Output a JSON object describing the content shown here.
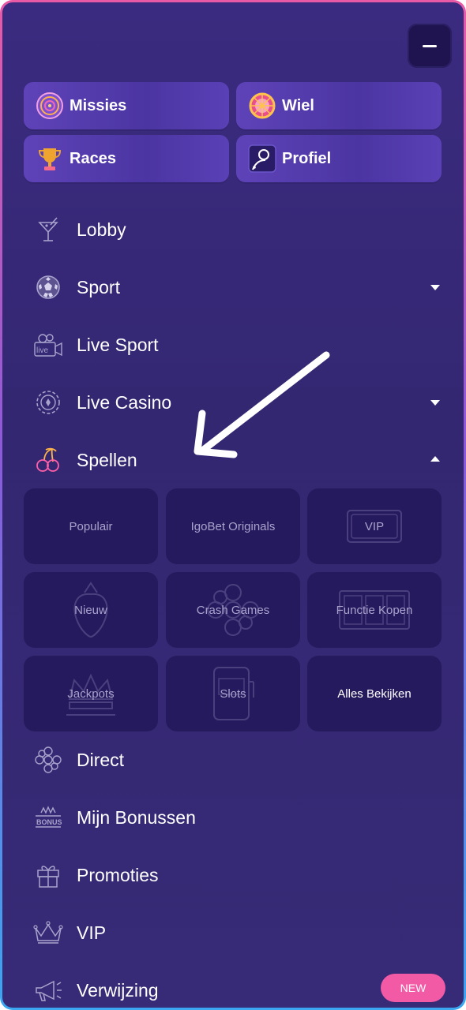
{
  "quick_actions": [
    {
      "label": "Missies",
      "icon": "target-icon"
    },
    {
      "label": "Wiel",
      "icon": "wheel-icon"
    },
    {
      "label": "Races",
      "icon": "trophy-icon"
    },
    {
      "label": "Profiel",
      "icon": "profile-icon"
    }
  ],
  "menu": [
    {
      "label": "Lobby",
      "icon": "cocktail-icon"
    },
    {
      "label": "Sport",
      "icon": "soccer-ball-icon",
      "caret": "down"
    },
    {
      "label": "Live Sport",
      "icon": "live-camera-icon"
    },
    {
      "label": "Live Casino",
      "icon": "casino-chip-icon",
      "caret": "down"
    },
    {
      "label": "Spellen",
      "icon": "cherries-icon",
      "caret": "up"
    },
    {
      "label": "Direct",
      "icon": "flower-icon"
    },
    {
      "label": "Mijn Bonussen",
      "icon": "bonus-icon"
    },
    {
      "label": "Promoties",
      "icon": "gift-icon"
    },
    {
      "label": "VIP",
      "icon": "crown-icon"
    },
    {
      "label": "Verwijzing",
      "icon": "megaphone-icon",
      "badge": "NEW"
    }
  ],
  "games": [
    "Populair",
    "IgoBet Originals",
    "VIP",
    "Nieuw",
    "Crash Games",
    "Functie Kopen",
    "Jackpots",
    "Slots",
    "Alles Bekijken"
  ],
  "colors": {
    "accent_pink": "#f35aa5",
    "panel": "#352873",
    "tile": "#261a5e"
  }
}
